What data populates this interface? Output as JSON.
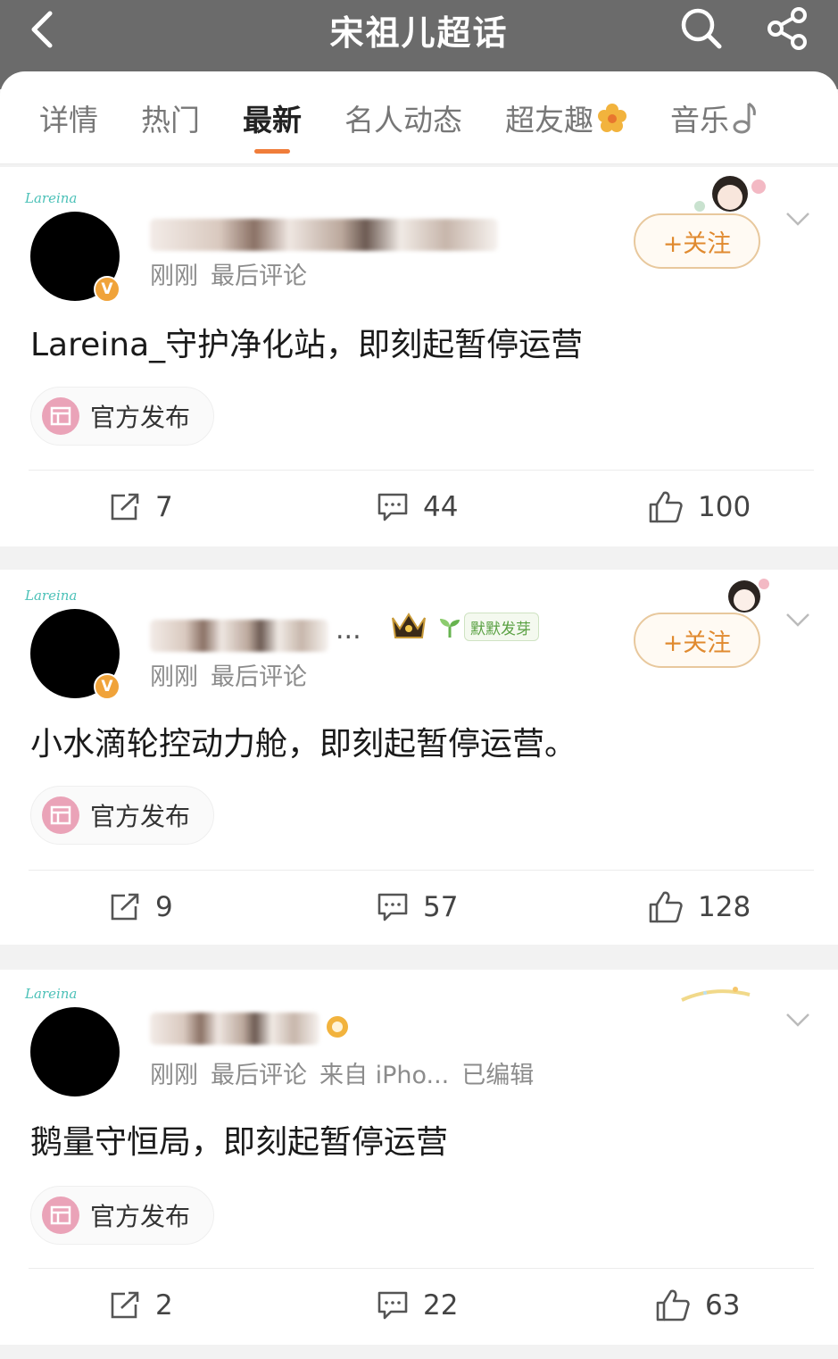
{
  "header": {
    "title": "宋祖儿超话",
    "icons": [
      "back-icon",
      "search-icon",
      "share-icon"
    ]
  },
  "tabs": [
    {
      "label": "详情"
    },
    {
      "label": "热门"
    },
    {
      "label": "最新",
      "active": true
    },
    {
      "label": "名人动态"
    },
    {
      "label": "超友趣"
    },
    {
      "label": "音乐"
    }
  ],
  "follow_label": "+关注",
  "official_label": "官方发布",
  "frame_text": "Lareina",
  "posts": [
    {
      "meta": [
        "刚刚",
        "最后评论"
      ],
      "text": "Lareina_守护净化站，即刻起暂停运营",
      "reposts": "7",
      "comments": "44",
      "likes": "100"
    },
    {
      "name_suffix": "...",
      "badge": "默默发芽",
      "meta": [
        "刚刚",
        "最后评论"
      ],
      "text": "小水滴轮控动力舱，即刻起暂停运营。",
      "reposts": "9",
      "comments": "57",
      "likes": "128"
    },
    {
      "meta": [
        "刚刚",
        "最后评论",
        "来自 iPho...",
        "已编辑"
      ],
      "text": "鹅量守恒局，即刻起暂停运营",
      "reposts": "2",
      "comments": "22",
      "likes": "63"
    }
  ],
  "colors": {
    "accent": "#f07d3a",
    "header_bg": "#6b6b6b",
    "follow": "#e08a2f",
    "verified": "#f0a33a"
  }
}
